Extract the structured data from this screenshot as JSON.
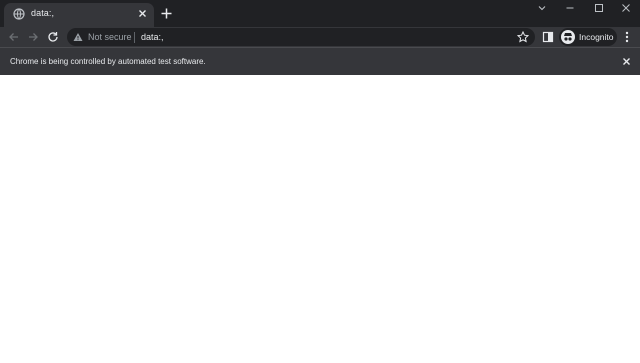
{
  "window": {
    "tab": {
      "title": "data:,",
      "favicon": "globe-icon",
      "close_icon": "close-icon"
    },
    "new_tab_icon": "plus-icon",
    "controls": [
      "chevron-down-icon",
      "minimize-icon",
      "maximize-icon",
      "close-icon"
    ]
  },
  "toolbar": {
    "back_icon": "arrow-left-icon",
    "forward_icon": "arrow-right-icon",
    "reload_icon": "reload-icon",
    "security_label": "Not secure",
    "url": "data:,",
    "bookmark_icon": "star-icon",
    "side_panel_icon": "side-panel-icon",
    "profile_label": "Incognito",
    "menu_icon": "three-dot-menu-icon"
  },
  "infobar": {
    "message": "Chrome is being controlled by automated test software.",
    "close_icon": "close-icon"
  },
  "colors": {
    "frame": "#202124",
    "toolbar": "#35363a",
    "text": "#e8eaed",
    "muted": "#9aa0a6",
    "page": "#ffffff"
  }
}
